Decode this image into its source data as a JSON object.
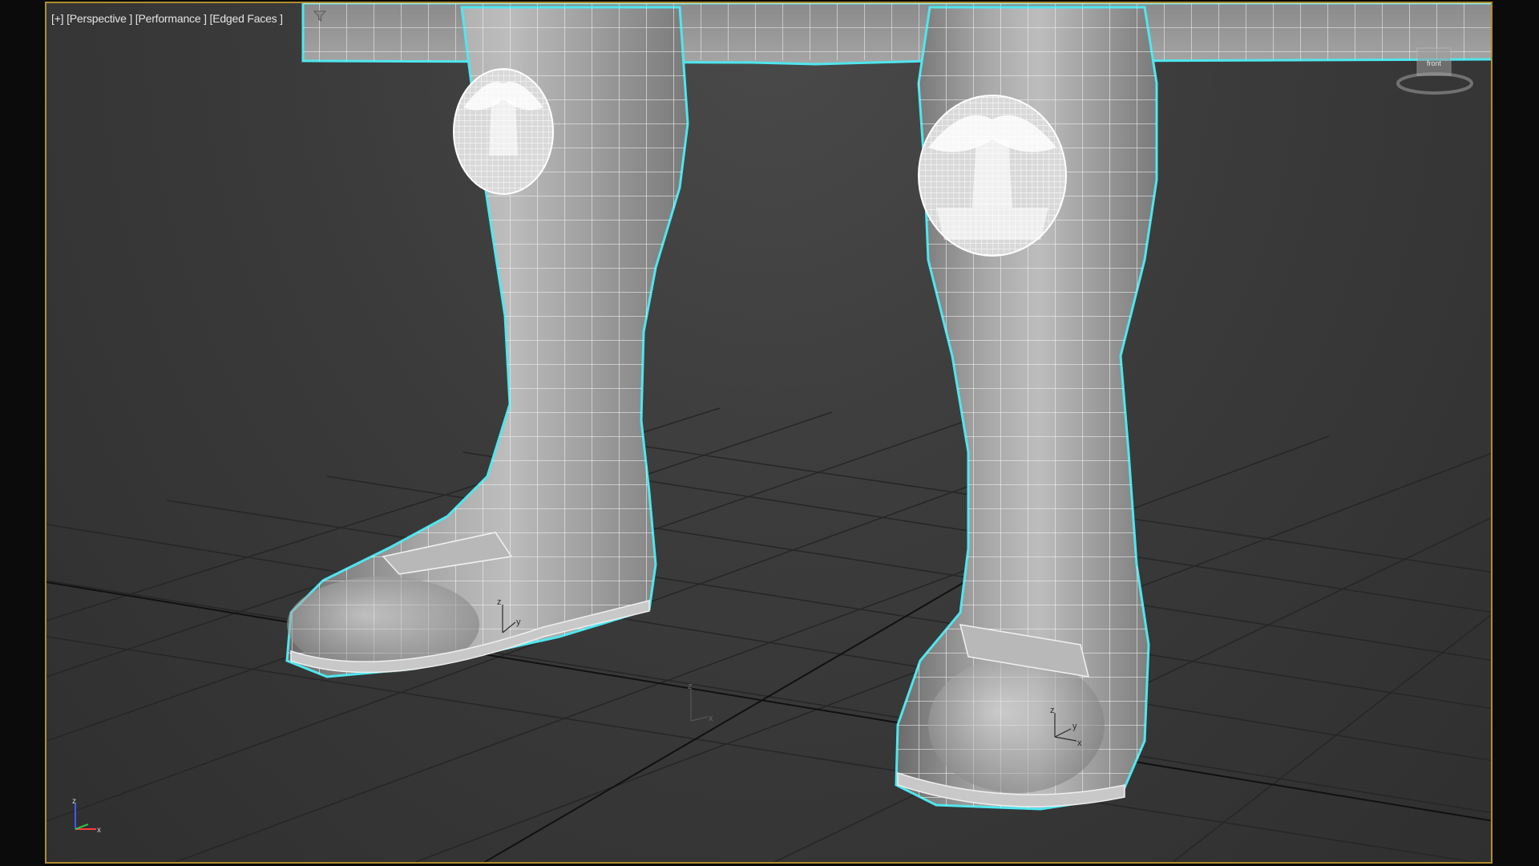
{
  "viewport": {
    "labels": {
      "plus": "[+]",
      "view": "[Perspective ]",
      "shading_mode": "[Performance ]",
      "display_mode": "[Edged Faces ]"
    },
    "viewcube_label": "front",
    "border_color": "#b08d2b",
    "selection_color": "#4fe6ee"
  },
  "gizmos": {
    "pivot_left_boot": {
      "z": "z",
      "y": "y"
    },
    "pivot_world": {
      "z": "z",
      "x": "x"
    },
    "pivot_right_boot": {
      "z": "z",
      "y": "y",
      "x": "x"
    },
    "axis_tripod": {
      "z": "z",
      "x": "x"
    }
  },
  "icons": {
    "filter": "funnel-icon",
    "viewcube": "viewcube-icon",
    "axis": "axis-tripod-icon"
  }
}
